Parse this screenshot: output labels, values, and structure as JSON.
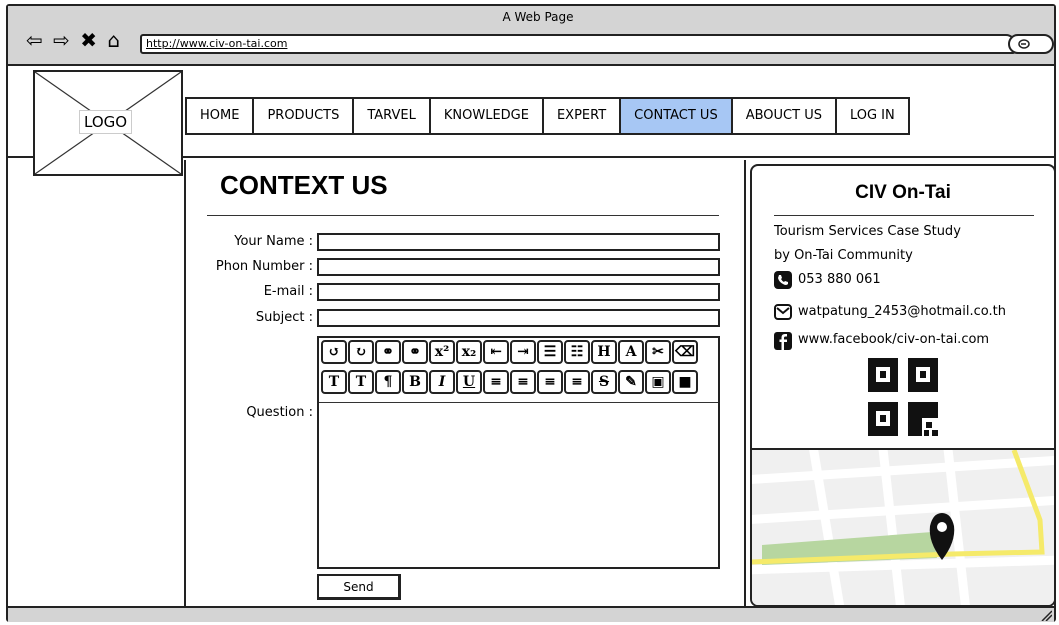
{
  "browser": {
    "title": "A Web Page",
    "url": "http://www.civ-on-tai.com",
    "nav_icons": "⇦ ⇨ ✖ ⌂"
  },
  "logo": {
    "text": "LOGO"
  },
  "nav": {
    "items": [
      {
        "label": "HOME"
      },
      {
        "label": "PRODUCTS"
      },
      {
        "label": "TARVEL"
      },
      {
        "label": "KNOWLEDGE"
      },
      {
        "label": "EXPERT"
      },
      {
        "label": "CONTACT US",
        "active": true
      },
      {
        "label": "ABOUCT US"
      },
      {
        "label": "LOG IN"
      }
    ]
  },
  "form": {
    "heading": "CONTEXT US",
    "labels": {
      "name": "Your Name :",
      "phone": "Phon Number :",
      "email": "E-mail :",
      "subject": "Subject :",
      "question": "Question :"
    },
    "values": {
      "name": "",
      "phone": "",
      "email": "",
      "subject": "",
      "question": ""
    },
    "send_label": "Send"
  },
  "editor_toolbar": {
    "row1": [
      "↺",
      "↻",
      "⚭",
      "⚭",
      "x²",
      "x₂",
      "⇤",
      "⇥",
      "☰",
      "☷",
      "H",
      "A",
      "✂",
      "⌫"
    ],
    "row2": [
      "T",
      "T",
      "¶",
      "B",
      "I",
      "U",
      "≡",
      "≡",
      "≡",
      "≡",
      "S",
      "✎",
      "▣",
      "■"
    ]
  },
  "sidebar": {
    "title": "CIV On-Tai",
    "line1": "Tourism Services Case Study",
    "line2": "by On-Tai Community",
    "phone": "053 880 061",
    "email": "watpatung_2453@hotmail.co.th",
    "facebook": "www.facebook/civ-on-tai.com"
  },
  "colors": {
    "active_nav": "#a7c7f4",
    "chrome": "#d4d4d4",
    "map_road": "#f5ea6a",
    "map_park": "#b7d6a0"
  }
}
